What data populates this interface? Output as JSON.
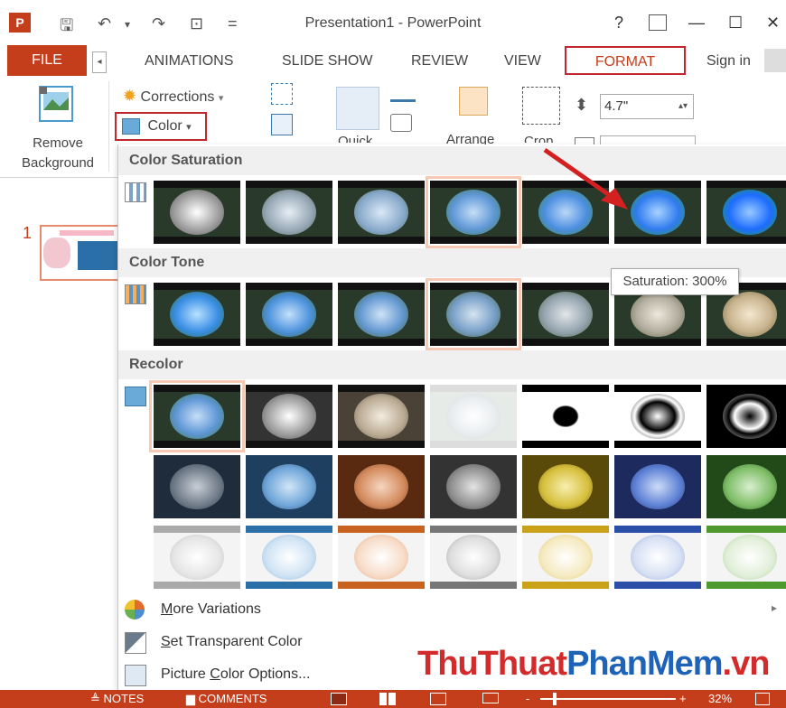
{
  "window": {
    "title": "Presentation1 - PowerPoint",
    "app_badge": "P",
    "help": "?",
    "restore_icon": "ribbon-display-icon",
    "minimize": "—",
    "maximize": "☐",
    "close": "✕"
  },
  "quick_access": {
    "save": "🖫",
    "undo": "↶",
    "undo_dd": "▾",
    "redo": "↷",
    "start": "⊡",
    "customize": "="
  },
  "tabs": {
    "file": "FILE",
    "scroll": "◂",
    "items": [
      "ANIMATIONS",
      "SLIDE SHOW",
      "REVIEW",
      "VIEW"
    ],
    "format": "FORMAT",
    "sign_in": "Sign in"
  },
  "ribbon": {
    "remove_background_line1": "Remove",
    "remove_background_line2": "Background",
    "corrections": "Corrections",
    "corrections_dd": "▾",
    "color": "Color",
    "color_dd": "▾",
    "quick_styles": "Quick",
    "arrange": "Arrange",
    "crop": "Crop",
    "height_value": "4.7\"",
    "spinner": "⬍"
  },
  "thumbnails": {
    "slide_number": "1"
  },
  "gallery": {
    "sections": {
      "saturation": "Color Saturation",
      "tone": "Color Tone",
      "recolor": "Recolor"
    },
    "tooltip": "Saturation: 300%",
    "menu": {
      "more_variations_u": "M",
      "more_variations_rest": "ore Variations",
      "set_transparent_u": "S",
      "set_transparent_rest": "et Transparent Color",
      "picture_color_pre": "Picture ",
      "picture_color_u": "C",
      "picture_color_rest": "olor Options...",
      "submenu_arrow": "▸"
    }
  },
  "watermark": {
    "part1": "ThuThuat",
    "part2": "PhanMem",
    "part3": ".vn",
    "color1": "#d22b2b",
    "color2": "#1e63b8",
    "color3": "#d22b2b"
  },
  "statusbar": {
    "notes": "≜ NOTES",
    "comments": "▆ COMMENTS",
    "zoom_minus": "-",
    "zoom_plus": "+",
    "zoom_value": "32%",
    "bg_color": "#c43e1c"
  },
  "colors": {
    "accent": "#c43e1c",
    "highlight_box": "#c0282d",
    "selection": "#f7c9b3"
  }
}
